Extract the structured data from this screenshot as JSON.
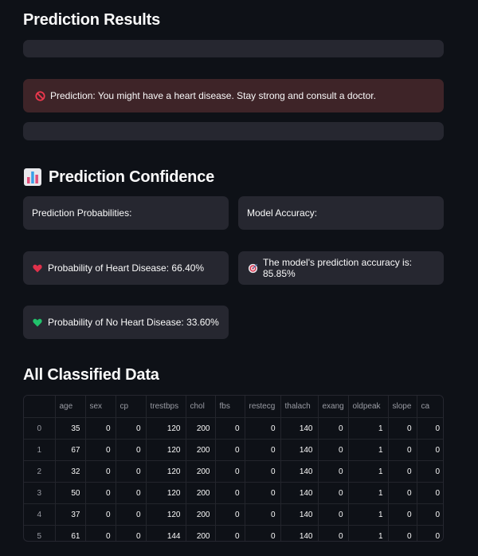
{
  "results": {
    "title": "Prediction Results",
    "alert_text": "Prediction: You might have a heart disease. Stay strong and consult a doctor."
  },
  "confidence": {
    "title": "Prediction Confidence",
    "probabilities_label": "Prediction Probabilities:",
    "accuracy_label": "Model Accuracy:",
    "heart_disease": "Probability of Heart Disease: 66.40%",
    "no_heart_disease": "Probability of No Heart Disease: 33.60%",
    "accuracy_text": "The model's prediction accuracy is: 85.85%"
  },
  "table": {
    "title": "All Classified Data",
    "columns": [
      "age",
      "sex",
      "cp",
      "trestbps",
      "chol",
      "fbs",
      "restecg",
      "thalach",
      "exang",
      "oldpeak",
      "slope",
      "ca"
    ],
    "rows": [
      {
        "index": "0",
        "values": [
          "35",
          "0",
          "0",
          "120",
          "200",
          "0",
          "0",
          "140",
          "0",
          "1",
          "0",
          "0"
        ]
      },
      {
        "index": "1",
        "values": [
          "67",
          "0",
          "0",
          "120",
          "200",
          "0",
          "0",
          "140",
          "0",
          "1",
          "0",
          "0"
        ]
      },
      {
        "index": "2",
        "values": [
          "32",
          "0",
          "0",
          "120",
          "200",
          "0",
          "0",
          "140",
          "0",
          "1",
          "0",
          "0"
        ]
      },
      {
        "index": "3",
        "values": [
          "50",
          "0",
          "0",
          "120",
          "200",
          "0",
          "0",
          "140",
          "0",
          "1",
          "0",
          "0"
        ]
      },
      {
        "index": "4",
        "values": [
          "37",
          "0",
          "0",
          "120",
          "200",
          "0",
          "0",
          "140",
          "0",
          "1",
          "0",
          "0"
        ]
      },
      {
        "index": "5",
        "values": [
          "61",
          "0",
          "0",
          "144",
          "200",
          "0",
          "0",
          "140",
          "0",
          "1",
          "0",
          "0"
        ]
      }
    ]
  },
  "colors": {
    "background": "#0e1117",
    "card": "#262730",
    "error_bg": "#3e2428",
    "heart_red": "#e0314b",
    "heart_green": "#21c26b"
  }
}
